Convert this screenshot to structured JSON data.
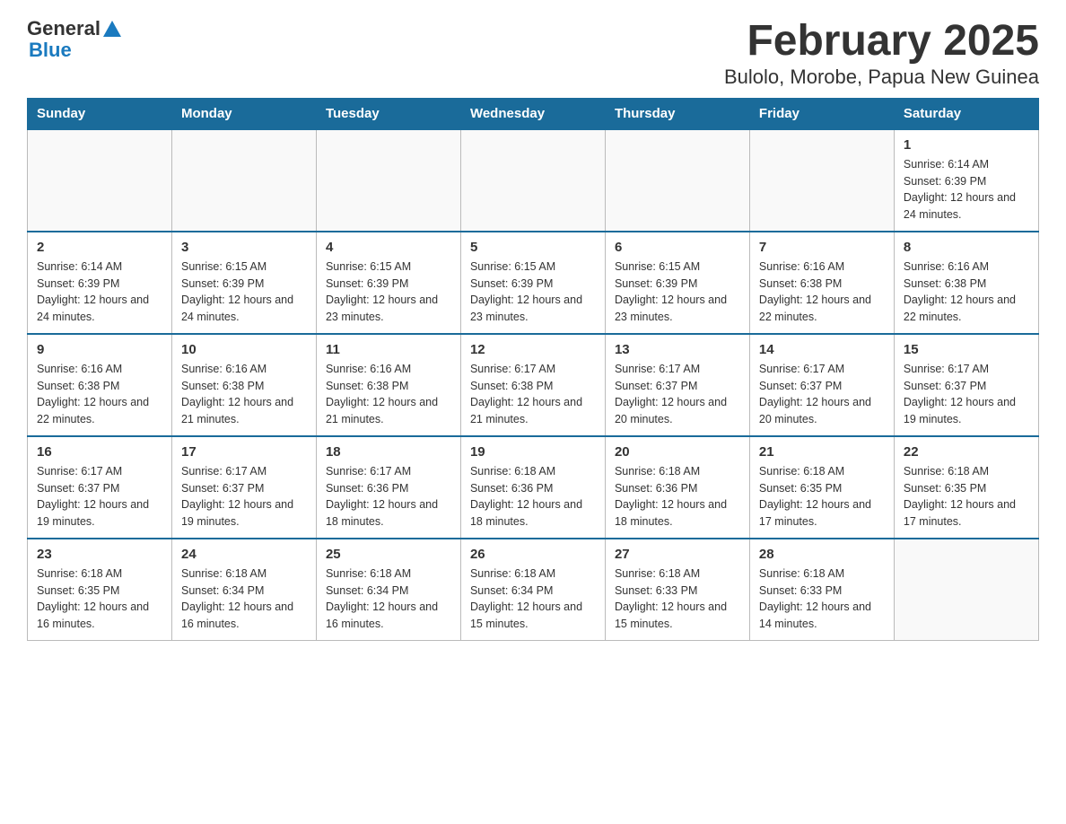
{
  "logo": {
    "text_general": "General",
    "text_blue": "Blue",
    "tagline": "GeneralBlue"
  },
  "title": "February 2025",
  "subtitle": "Bulolo, Morobe, Papua New Guinea",
  "days_of_week": [
    "Sunday",
    "Monday",
    "Tuesday",
    "Wednesday",
    "Thursday",
    "Friday",
    "Saturday"
  ],
  "weeks": [
    [
      {
        "day": "",
        "info": ""
      },
      {
        "day": "",
        "info": ""
      },
      {
        "day": "",
        "info": ""
      },
      {
        "day": "",
        "info": ""
      },
      {
        "day": "",
        "info": ""
      },
      {
        "day": "",
        "info": ""
      },
      {
        "day": "1",
        "info": "Sunrise: 6:14 AM\nSunset: 6:39 PM\nDaylight: 12 hours and 24 minutes."
      }
    ],
    [
      {
        "day": "2",
        "info": "Sunrise: 6:14 AM\nSunset: 6:39 PM\nDaylight: 12 hours and 24 minutes."
      },
      {
        "day": "3",
        "info": "Sunrise: 6:15 AM\nSunset: 6:39 PM\nDaylight: 12 hours and 24 minutes."
      },
      {
        "day": "4",
        "info": "Sunrise: 6:15 AM\nSunset: 6:39 PM\nDaylight: 12 hours and 23 minutes."
      },
      {
        "day": "5",
        "info": "Sunrise: 6:15 AM\nSunset: 6:39 PM\nDaylight: 12 hours and 23 minutes."
      },
      {
        "day": "6",
        "info": "Sunrise: 6:15 AM\nSunset: 6:39 PM\nDaylight: 12 hours and 23 minutes."
      },
      {
        "day": "7",
        "info": "Sunrise: 6:16 AM\nSunset: 6:38 PM\nDaylight: 12 hours and 22 minutes."
      },
      {
        "day": "8",
        "info": "Sunrise: 6:16 AM\nSunset: 6:38 PM\nDaylight: 12 hours and 22 minutes."
      }
    ],
    [
      {
        "day": "9",
        "info": "Sunrise: 6:16 AM\nSunset: 6:38 PM\nDaylight: 12 hours and 22 minutes."
      },
      {
        "day": "10",
        "info": "Sunrise: 6:16 AM\nSunset: 6:38 PM\nDaylight: 12 hours and 21 minutes."
      },
      {
        "day": "11",
        "info": "Sunrise: 6:16 AM\nSunset: 6:38 PM\nDaylight: 12 hours and 21 minutes."
      },
      {
        "day": "12",
        "info": "Sunrise: 6:17 AM\nSunset: 6:38 PM\nDaylight: 12 hours and 21 minutes."
      },
      {
        "day": "13",
        "info": "Sunrise: 6:17 AM\nSunset: 6:37 PM\nDaylight: 12 hours and 20 minutes."
      },
      {
        "day": "14",
        "info": "Sunrise: 6:17 AM\nSunset: 6:37 PM\nDaylight: 12 hours and 20 minutes."
      },
      {
        "day": "15",
        "info": "Sunrise: 6:17 AM\nSunset: 6:37 PM\nDaylight: 12 hours and 19 minutes."
      }
    ],
    [
      {
        "day": "16",
        "info": "Sunrise: 6:17 AM\nSunset: 6:37 PM\nDaylight: 12 hours and 19 minutes."
      },
      {
        "day": "17",
        "info": "Sunrise: 6:17 AM\nSunset: 6:37 PM\nDaylight: 12 hours and 19 minutes."
      },
      {
        "day": "18",
        "info": "Sunrise: 6:17 AM\nSunset: 6:36 PM\nDaylight: 12 hours and 18 minutes."
      },
      {
        "day": "19",
        "info": "Sunrise: 6:18 AM\nSunset: 6:36 PM\nDaylight: 12 hours and 18 minutes."
      },
      {
        "day": "20",
        "info": "Sunrise: 6:18 AM\nSunset: 6:36 PM\nDaylight: 12 hours and 18 minutes."
      },
      {
        "day": "21",
        "info": "Sunrise: 6:18 AM\nSunset: 6:35 PM\nDaylight: 12 hours and 17 minutes."
      },
      {
        "day": "22",
        "info": "Sunrise: 6:18 AM\nSunset: 6:35 PM\nDaylight: 12 hours and 17 minutes."
      }
    ],
    [
      {
        "day": "23",
        "info": "Sunrise: 6:18 AM\nSunset: 6:35 PM\nDaylight: 12 hours and 16 minutes."
      },
      {
        "day": "24",
        "info": "Sunrise: 6:18 AM\nSunset: 6:34 PM\nDaylight: 12 hours and 16 minutes."
      },
      {
        "day": "25",
        "info": "Sunrise: 6:18 AM\nSunset: 6:34 PM\nDaylight: 12 hours and 16 minutes."
      },
      {
        "day": "26",
        "info": "Sunrise: 6:18 AM\nSunset: 6:34 PM\nDaylight: 12 hours and 15 minutes."
      },
      {
        "day": "27",
        "info": "Sunrise: 6:18 AM\nSunset: 6:33 PM\nDaylight: 12 hours and 15 minutes."
      },
      {
        "day": "28",
        "info": "Sunrise: 6:18 AM\nSunset: 6:33 PM\nDaylight: 12 hours and 14 minutes."
      },
      {
        "day": "",
        "info": ""
      }
    ]
  ]
}
